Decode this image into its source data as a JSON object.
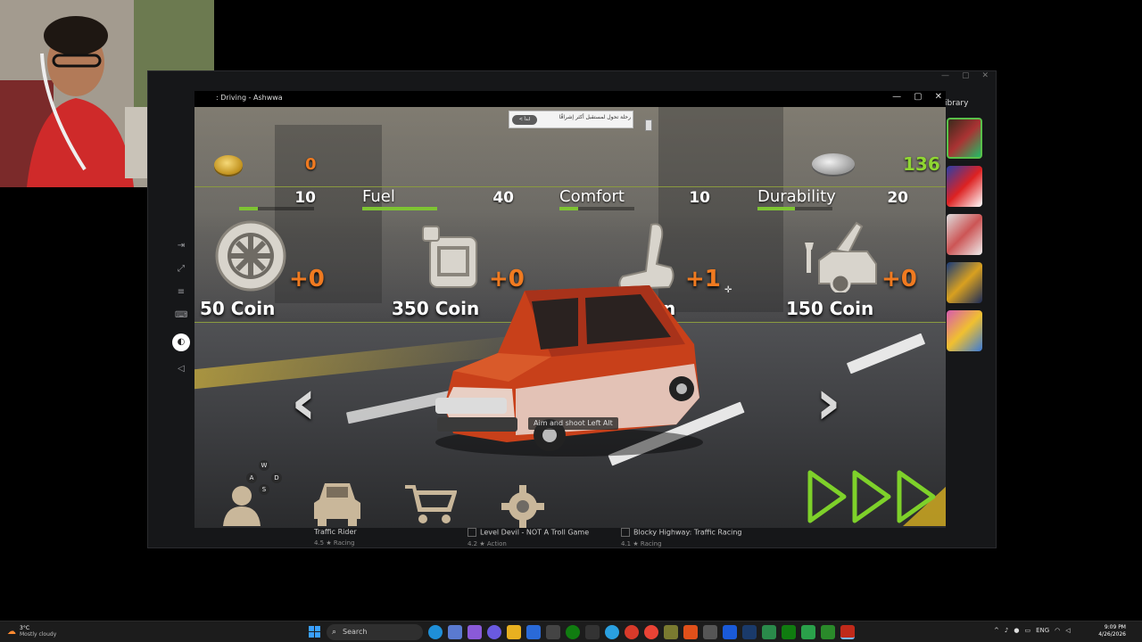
{
  "launcher": {
    "library_label": "ibrary",
    "window_controls": [
      "—",
      "▢",
      "✕"
    ],
    "games": [
      {
        "title": "Traffic Rider",
        "rating": "4.5",
        "genre": "Racing"
      },
      {
        "title": "Level Devil - NOT A Troll Game",
        "rating": "4.2",
        "genre": "Action"
      },
      {
        "title": "Blocky Highway: Traffic Racing",
        "rating": "4.1",
        "genre": "Racing"
      }
    ]
  },
  "emulator": {
    "title": ": Driving - Ashwwa",
    "controls": {
      "minimize": "—",
      "maximize": "▢",
      "close": "✕"
    }
  },
  "ad": {
    "button_label": "< ‏ابدأ",
    "text": "رحلة تحول لمستقبل أكثر إشراقًا"
  },
  "hud": {
    "gold_coins": "0",
    "silver_coins": "136"
  },
  "stats": [
    {
      "label": "",
      "value": "10",
      "fill": 0.25
    },
    {
      "label": "Fuel",
      "value": "40",
      "fill": 1.0
    },
    {
      "label": "Comfort",
      "value": "10",
      "fill": 0.25
    },
    {
      "label": "Durability",
      "value": "20",
      "fill": 0.5
    }
  ],
  "upgrades": [
    {
      "icon": "wheel-icon",
      "bonus": "+0",
      "price": "50 Coin"
    },
    {
      "icon": "fuel-can-icon",
      "bonus": "+0",
      "price": "350 Coin"
    },
    {
      "icon": "car-seat-icon",
      "bonus": "+1",
      "price": "100 Coin"
    },
    {
      "icon": "repair-car-icon",
      "bonus": "+0",
      "price": "150 Coin"
    }
  ],
  "tooltip": "Aim and shoot   Left Alt",
  "wasd": {
    "up": "W",
    "left": "A",
    "right": "D",
    "down": "S"
  },
  "nav": {
    "prev": "‹",
    "next": "›"
  },
  "taskbar": {
    "temperature": "3°C",
    "weather": "Mostly cloudy",
    "search": "Search",
    "language": "ENG",
    "time": "9:09 PM",
    "date": "4/26/2026"
  },
  "colors": {
    "accent_green": "#8fd632",
    "accent_orange": "#f07a20",
    "car_red": "#c8401a"
  }
}
